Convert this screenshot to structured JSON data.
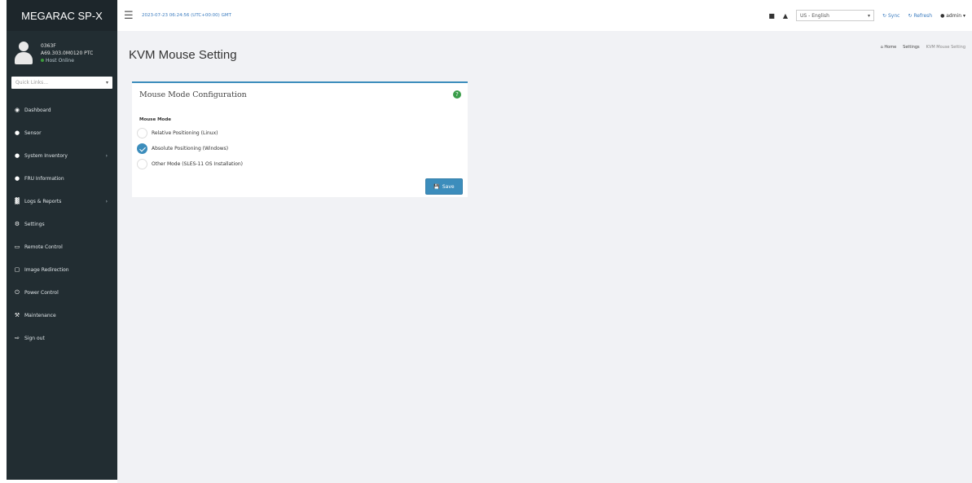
{
  "brand": "MEGARAC SP-X",
  "user": {
    "line1": "0363F",
    "line2": "A69.303.0M0120 PTC",
    "status": "Host Online"
  },
  "quick_links": {
    "placeholder": "Quick Links..."
  },
  "nav": [
    {
      "label": "Dashboard",
      "icon": "dashboard-icon",
      "glyph": "◉"
    },
    {
      "label": "Sensor",
      "icon": "sensor-icon",
      "glyph": "●"
    },
    {
      "label": "System Inventory",
      "icon": "inventory-icon",
      "glyph": "●",
      "chevron": true
    },
    {
      "label": "FRU Information",
      "icon": "fru-icon",
      "glyph": "●"
    },
    {
      "label": "Logs & Reports",
      "icon": "logs-icon",
      "glyph": "▓",
      "chevron": true
    },
    {
      "label": "Settings",
      "icon": "gear-icon",
      "glyph": "⚙"
    },
    {
      "label": "Remote Control",
      "icon": "monitor-icon",
      "glyph": "▭"
    },
    {
      "label": "Image Redirection",
      "icon": "image-icon",
      "glyph": "▢"
    },
    {
      "label": "Power Control",
      "icon": "power-icon",
      "glyph": "⏻"
    },
    {
      "label": "Maintenance",
      "icon": "wrench-icon",
      "glyph": "⚒"
    },
    {
      "label": "Sign out",
      "icon": "signout-icon",
      "glyph": "⇨"
    }
  ],
  "topbar": {
    "datetime": "2023-07-23 06:24:56 (UTC+00:00) GMT",
    "language": "US - English",
    "sync": "Sync",
    "refresh": "Refresh",
    "admin": "admin"
  },
  "page": {
    "title": "KVM Mouse Setting",
    "breadcrumb": [
      "Home",
      "Settings",
      "KVM Mouse Setting"
    ]
  },
  "mouse_config": {
    "title": "Mouse Mode Configuration",
    "field_label": "Mouse Mode",
    "options": [
      {
        "label": "Relative Positioning (Linux)",
        "checked": false
      },
      {
        "label": "Absolute Positioning (Windows)",
        "checked": true
      },
      {
        "label": "Other Mode (SLES-11 OS Installation)",
        "checked": false
      }
    ],
    "save_label": "Save"
  },
  "colors": {
    "sidebar_bg": "#222d32",
    "accent": "#3c8dbc",
    "help": "#3a9d4a"
  }
}
